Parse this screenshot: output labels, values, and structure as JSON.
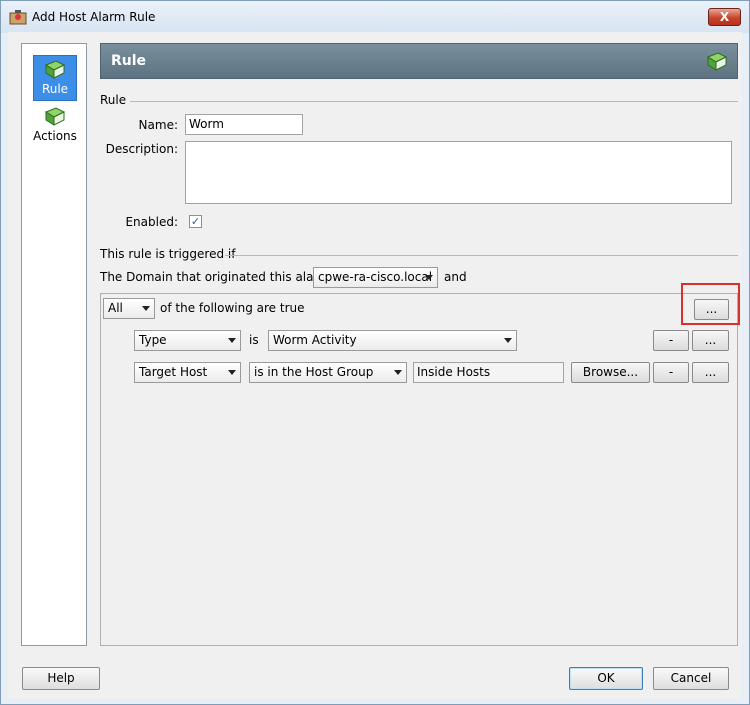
{
  "window": {
    "title": "Add Host Alarm Rule",
    "close_label": "X"
  },
  "nav": {
    "items": [
      {
        "label": "Rule",
        "icon": "book-icon",
        "selected": true
      },
      {
        "label": "Actions",
        "icon": "book-icon",
        "selected": false
      }
    ]
  },
  "panel": {
    "header_title": "Rule",
    "rule_section": "Rule",
    "name_label": "Name:",
    "name_value": "Worm",
    "description_label": "Description:",
    "description_value": "",
    "enabled_label": "Enabled:",
    "enabled_checked": true,
    "trigger_section": "This rule is triggered if",
    "domain_text": "The Domain that originated this alarm is",
    "domain_value": "cpwe-ra-cisco.local",
    "domain_and": "and",
    "match_value": "All",
    "match_text": "of the following are true",
    "more_label": "...",
    "conditions": [
      {
        "field": "Type",
        "operator_text": "is",
        "value": "Worm Activity",
        "remove_label": "-",
        "more_label": "..."
      },
      {
        "field": "Target Host",
        "operator": "is in the Host Group",
        "value": "Inside Hosts",
        "browse_label": "Browse...",
        "remove_label": "-",
        "more_label": "..."
      }
    ]
  },
  "footer": {
    "help_label": "Help",
    "ok_label": "OK",
    "cancel_label": "Cancel"
  },
  "colors": {
    "accent_highlight": "#d9302b",
    "header_bg": "#6a7f8d",
    "nav_selected": "#3d8ee6"
  }
}
